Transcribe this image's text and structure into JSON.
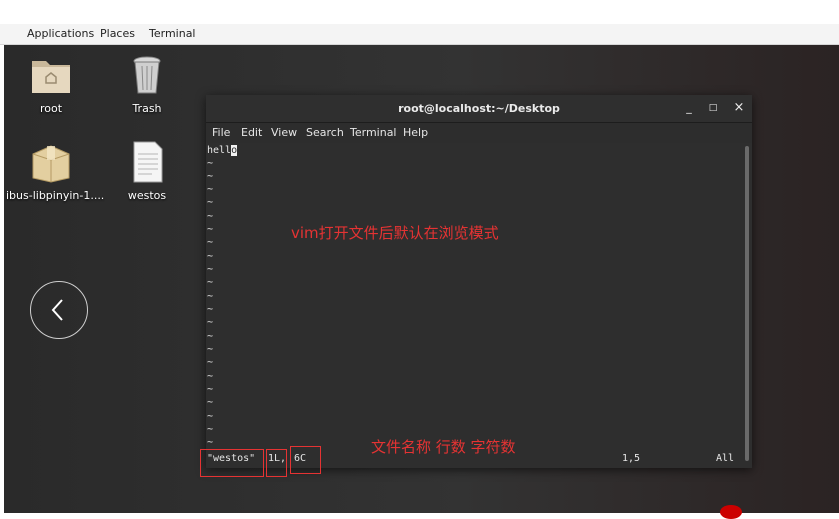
{
  "top_panel": {
    "applications": "Applications",
    "places": "Places",
    "terminal": "Terminal"
  },
  "desktop_icons": [
    {
      "label": "root",
      "icon": "home-folder-icon"
    },
    {
      "label": "Trash",
      "icon": "trash-icon"
    },
    {
      "label": "ibus-libpinyin-1....",
      "icon": "package-icon"
    },
    {
      "label": "westos",
      "icon": "text-file-icon"
    }
  ],
  "window": {
    "title": "root@localhost:~/Desktop",
    "minimize": "_",
    "maximize": "□",
    "close": "×",
    "menu": [
      "File",
      "Edit",
      "View",
      "Search",
      "Terminal",
      "Help"
    ]
  },
  "vim": {
    "first_line_text": "hell",
    "cursor_char": "o",
    "tilde": "~",
    "status_file": "\"westos\"",
    "status_lines": "1L,",
    "status_chars": "6C",
    "status_pos": "1,5",
    "status_all": "All"
  },
  "annotations": {
    "top": "vim打开文件后默认在浏览模式",
    "bottom": "文件名称 行数 字符数",
    "color": "#e53333"
  }
}
